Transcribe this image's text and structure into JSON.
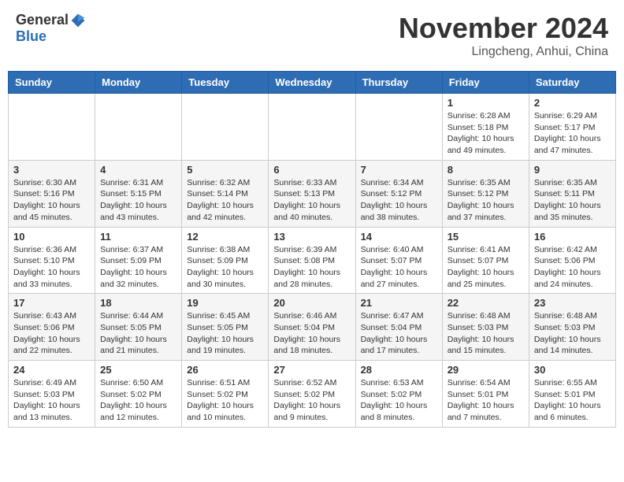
{
  "header": {
    "logo_general": "General",
    "logo_blue": "Blue",
    "title": "November 2024",
    "location": "Lingcheng, Anhui, China"
  },
  "days_of_week": [
    "Sunday",
    "Monday",
    "Tuesday",
    "Wednesday",
    "Thursday",
    "Friday",
    "Saturday"
  ],
  "weeks": [
    [
      {
        "day": "",
        "info": ""
      },
      {
        "day": "",
        "info": ""
      },
      {
        "day": "",
        "info": ""
      },
      {
        "day": "",
        "info": ""
      },
      {
        "day": "",
        "info": ""
      },
      {
        "day": "1",
        "info": "Sunrise: 6:28 AM\nSunset: 5:18 PM\nDaylight: 10 hours and 49 minutes."
      },
      {
        "day": "2",
        "info": "Sunrise: 6:29 AM\nSunset: 5:17 PM\nDaylight: 10 hours and 47 minutes."
      }
    ],
    [
      {
        "day": "3",
        "info": "Sunrise: 6:30 AM\nSunset: 5:16 PM\nDaylight: 10 hours and 45 minutes."
      },
      {
        "day": "4",
        "info": "Sunrise: 6:31 AM\nSunset: 5:15 PM\nDaylight: 10 hours and 43 minutes."
      },
      {
        "day": "5",
        "info": "Sunrise: 6:32 AM\nSunset: 5:14 PM\nDaylight: 10 hours and 42 minutes."
      },
      {
        "day": "6",
        "info": "Sunrise: 6:33 AM\nSunset: 5:13 PM\nDaylight: 10 hours and 40 minutes."
      },
      {
        "day": "7",
        "info": "Sunrise: 6:34 AM\nSunset: 5:12 PM\nDaylight: 10 hours and 38 minutes."
      },
      {
        "day": "8",
        "info": "Sunrise: 6:35 AM\nSunset: 5:12 PM\nDaylight: 10 hours and 37 minutes."
      },
      {
        "day": "9",
        "info": "Sunrise: 6:35 AM\nSunset: 5:11 PM\nDaylight: 10 hours and 35 minutes."
      }
    ],
    [
      {
        "day": "10",
        "info": "Sunrise: 6:36 AM\nSunset: 5:10 PM\nDaylight: 10 hours and 33 minutes."
      },
      {
        "day": "11",
        "info": "Sunrise: 6:37 AM\nSunset: 5:09 PM\nDaylight: 10 hours and 32 minutes."
      },
      {
        "day": "12",
        "info": "Sunrise: 6:38 AM\nSunset: 5:09 PM\nDaylight: 10 hours and 30 minutes."
      },
      {
        "day": "13",
        "info": "Sunrise: 6:39 AM\nSunset: 5:08 PM\nDaylight: 10 hours and 28 minutes."
      },
      {
        "day": "14",
        "info": "Sunrise: 6:40 AM\nSunset: 5:07 PM\nDaylight: 10 hours and 27 minutes."
      },
      {
        "day": "15",
        "info": "Sunrise: 6:41 AM\nSunset: 5:07 PM\nDaylight: 10 hours and 25 minutes."
      },
      {
        "day": "16",
        "info": "Sunrise: 6:42 AM\nSunset: 5:06 PM\nDaylight: 10 hours and 24 minutes."
      }
    ],
    [
      {
        "day": "17",
        "info": "Sunrise: 6:43 AM\nSunset: 5:06 PM\nDaylight: 10 hours and 22 minutes."
      },
      {
        "day": "18",
        "info": "Sunrise: 6:44 AM\nSunset: 5:05 PM\nDaylight: 10 hours and 21 minutes."
      },
      {
        "day": "19",
        "info": "Sunrise: 6:45 AM\nSunset: 5:05 PM\nDaylight: 10 hours and 19 minutes."
      },
      {
        "day": "20",
        "info": "Sunrise: 6:46 AM\nSunset: 5:04 PM\nDaylight: 10 hours and 18 minutes."
      },
      {
        "day": "21",
        "info": "Sunrise: 6:47 AM\nSunset: 5:04 PM\nDaylight: 10 hours and 17 minutes."
      },
      {
        "day": "22",
        "info": "Sunrise: 6:48 AM\nSunset: 5:03 PM\nDaylight: 10 hours and 15 minutes."
      },
      {
        "day": "23",
        "info": "Sunrise: 6:48 AM\nSunset: 5:03 PM\nDaylight: 10 hours and 14 minutes."
      }
    ],
    [
      {
        "day": "24",
        "info": "Sunrise: 6:49 AM\nSunset: 5:03 PM\nDaylight: 10 hours and 13 minutes."
      },
      {
        "day": "25",
        "info": "Sunrise: 6:50 AM\nSunset: 5:02 PM\nDaylight: 10 hours and 12 minutes."
      },
      {
        "day": "26",
        "info": "Sunrise: 6:51 AM\nSunset: 5:02 PM\nDaylight: 10 hours and 10 minutes."
      },
      {
        "day": "27",
        "info": "Sunrise: 6:52 AM\nSunset: 5:02 PM\nDaylight: 10 hours and 9 minutes."
      },
      {
        "day": "28",
        "info": "Sunrise: 6:53 AM\nSunset: 5:02 PM\nDaylight: 10 hours and 8 minutes."
      },
      {
        "day": "29",
        "info": "Sunrise: 6:54 AM\nSunset: 5:01 PM\nDaylight: 10 hours and 7 minutes."
      },
      {
        "day": "30",
        "info": "Sunrise: 6:55 AM\nSunset: 5:01 PM\nDaylight: 10 hours and 6 minutes."
      }
    ]
  ]
}
